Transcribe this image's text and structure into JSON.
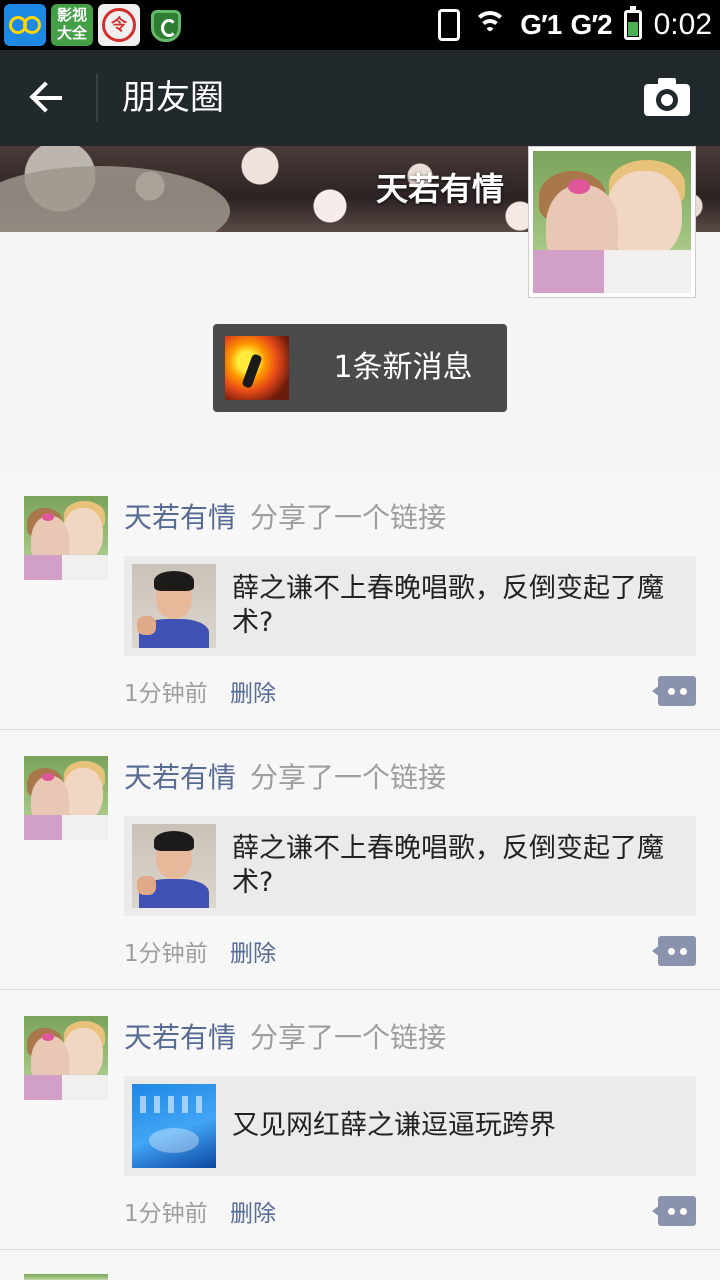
{
  "status_bar": {
    "apps": [
      {
        "name": "infinity-app-icon"
      },
      {
        "name": "yingshi-daquan-app-icon",
        "label": "影视大全"
      },
      {
        "name": "ling-app-icon",
        "label": "令"
      },
      {
        "name": "green-shield-app-icon"
      }
    ],
    "network": "G′1  G′2",
    "time": "0:02",
    "battery_level": 0.6
  },
  "header": {
    "title": "朋友圈",
    "back_icon": "arrow-left-icon",
    "camera_icon": "camera-icon"
  },
  "cover": {
    "user_name": "天若有情"
  },
  "notification": {
    "text": "1条新消息"
  },
  "posts": [
    {
      "author": "天若有情",
      "action": "分享了一个链接",
      "link_title": "薛之谦不上春晚唱歌，反倒变起了魔术?",
      "thumb": "person",
      "time": "1分钟前",
      "delete_label": "删除"
    },
    {
      "author": "天若有情",
      "action": "分享了一个链接",
      "link_title": "薛之谦不上春晚唱歌，反倒变起了魔术?",
      "thumb": "person",
      "time": "1分钟前",
      "delete_label": "删除"
    },
    {
      "author": "天若有情",
      "action": "分享了一个链接",
      "link_title": "又见网红薛之谦逗逼玩跨界",
      "thumb": "desktop",
      "time": "1分钟前",
      "delete_label": "删除"
    }
  ],
  "colors": {
    "action_bar": "#22292c",
    "link_name": "#576b95",
    "comment_icon": "#8a93ad"
  }
}
